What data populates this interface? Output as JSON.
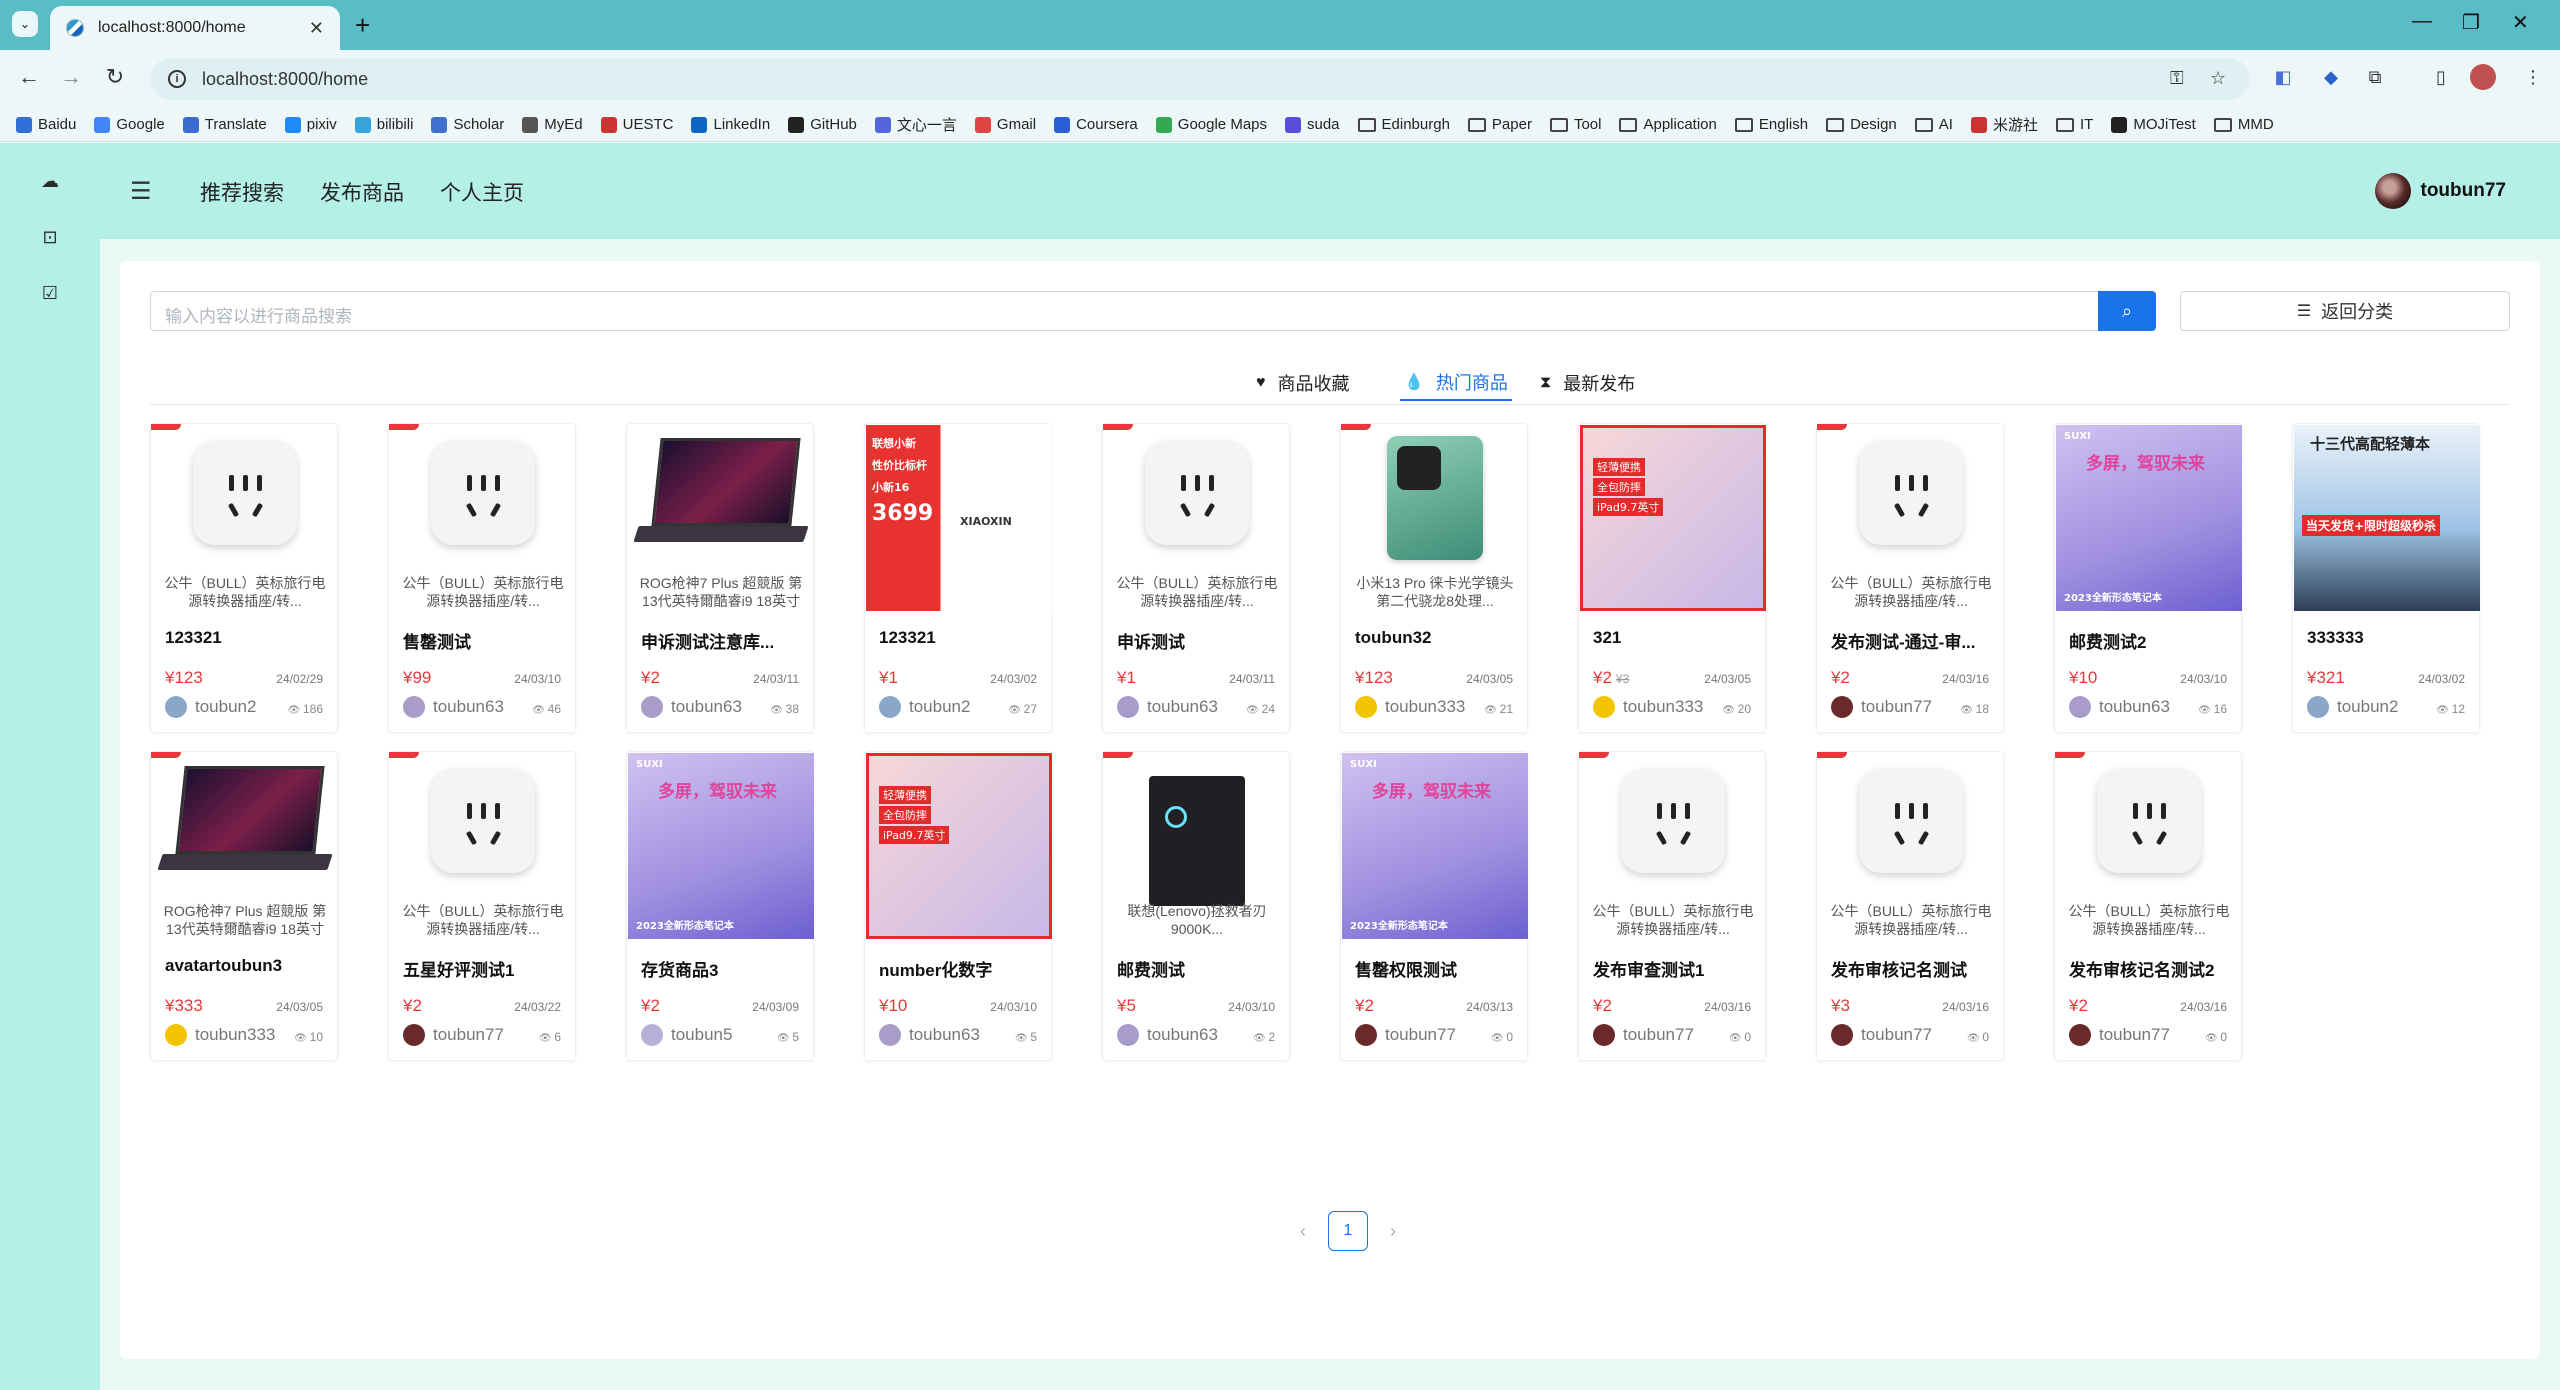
{
  "browser": {
    "tab_title": "localhost:8000/home",
    "url": "localhost:8000/home",
    "bookmarks": [
      "Baidu",
      "Google",
      "Translate",
      "pixiv",
      "bilibili",
      "Scholar",
      "MyEd",
      "UESTC",
      "LinkedIn",
      "GitHub",
      "文心一言",
      "Gmail",
      "Coursera",
      "Google Maps",
      "suda",
      "Edinburgh",
      "Paper",
      "Tool",
      "Application",
      "English",
      "Design",
      "AI",
      "米游社",
      "IT",
      "MOJiTest",
      "MMD"
    ],
    "folder_bookmarks": [
      "Edinburgh",
      "Paper",
      "Tool",
      "Application",
      "English",
      "Design",
      "AI",
      "IT",
      "MMD"
    ]
  },
  "nav": {
    "links": [
      "推荐搜索",
      "发布商品",
      "个人主页"
    ],
    "username": "toubun77"
  },
  "search": {
    "placeholder": "输入内容以进行商品搜索",
    "back_label": "返回分类"
  },
  "tabs": [
    {
      "label": "商品收藏",
      "icon": "heart-icon",
      "active": false
    },
    {
      "label": "热门商品",
      "icon": "flame-icon",
      "active": true
    },
    {
      "label": "最新发布",
      "icon": "hourglass-icon",
      "active": false
    }
  ],
  "products": [
    {
      "thumb": "plug",
      "desc": "公牛（BULL）英标旅行电源转换器插座/转...",
      "title": "123321",
      "price": "¥123",
      "old_price": "",
      "date": "24/02/29",
      "seller": "toubun2",
      "views": "186",
      "avatar": "#8aa6c8",
      "ribbon": true
    },
    {
      "thumb": "plug",
      "desc": "公牛（BULL）英标旅行电源转换器插座/转...",
      "title": "售罄测试",
      "price": "¥99",
      "old_price": "",
      "date": "24/03/10",
      "seller": "toubun63",
      "views": "46",
      "avatar": "#a89cc8",
      "ribbon": true
    },
    {
      "thumb": "laptop",
      "desc": "ROG枪神7 Plus 超競版 第13代英特爾酷睿i9 18英寸",
      "title": "申诉测试注意库...",
      "price": "¥2",
      "old_price": "",
      "date": "24/03/11",
      "seller": "toubun63",
      "views": "38",
      "avatar": "#a89cc8",
      "ribbon": false
    },
    {
      "thumb": "poster-red",
      "desc": "",
      "title": "123321",
      "price": "¥1",
      "old_price": "",
      "date": "24/03/02",
      "seller": "toubun2",
      "views": "27",
      "avatar": "#8aa6c8",
      "ribbon": false
    },
    {
      "thumb": "plug",
      "desc": "公牛（BULL）英标旅行电源转换器插座/转...",
      "title": "申诉测试",
      "price": "¥1",
      "old_price": "",
      "date": "24/03/11",
      "seller": "toubun63",
      "views": "24",
      "avatar": "#a89cc8",
      "ribbon": true
    },
    {
      "thumb": "phone",
      "desc": "小米13 Pro 徕卡光学镜头 第二代骁龙8处理...",
      "title": "toubun32",
      "price": "¥123",
      "old_price": "",
      "date": "24/03/05",
      "seller": "toubun333",
      "views": "21",
      "avatar": "#f5c400",
      "ribbon": true
    },
    {
      "thumb": "poster-tablet",
      "desc": "",
      "title": "321",
      "price": "¥2",
      "old_price": "¥3",
      "date": "24/03/05",
      "seller": "toubun333",
      "views": "20",
      "avatar": "#f5c400",
      "ribbon": false
    },
    {
      "thumb": "plug",
      "desc": "公牛（BULL）英标旅行电源转换器插座/转...",
      "title": "发布测试-通过-审...",
      "price": "¥2",
      "old_price": "",
      "date": "24/03/16",
      "seller": "toubun77",
      "views": "18",
      "avatar": "#6b2a2a",
      "ribbon": true
    },
    {
      "thumb": "poster-purple",
      "desc": "",
      "title": "邮费测试2",
      "price": "¥10",
      "old_price": "",
      "date": "24/03/10",
      "seller": "toubun63",
      "views": "16",
      "avatar": "#a89cc8",
      "ribbon": false
    },
    {
      "thumb": "poster-blue",
      "desc": "",
      "title": "333333",
      "price": "¥321",
      "old_price": "",
      "date": "24/03/02",
      "seller": "toubun2",
      "views": "12",
      "avatar": "#8aa6c8",
      "ribbon": false
    },
    {
      "thumb": "laptop",
      "desc": "ROG枪神7 Plus 超競版 第13代英特爾酷睿i9 18英寸",
      "title": "avatartoubun3",
      "price": "¥333",
      "old_price": "",
      "date": "24/03/05",
      "seller": "toubun333",
      "views": "10",
      "avatar": "#f5c400",
      "ribbon": true
    },
    {
      "thumb": "plug",
      "desc": "公牛（BULL）英标旅行电源转换器插座/转...",
      "title": "五星好评测试1",
      "price": "¥2",
      "old_price": "",
      "date": "24/03/22",
      "seller": "toubun77",
      "views": "6",
      "avatar": "#6b2a2a",
      "ribbon": true
    },
    {
      "thumb": "poster-purple",
      "desc": "",
      "title": "存货商品3",
      "price": "¥2",
      "old_price": "",
      "date": "24/03/09",
      "seller": "toubun5",
      "views": "5",
      "avatar": "#b8b0d8",
      "ribbon": false
    },
    {
      "thumb": "poster-tablet",
      "desc": "",
      "title": "number化数字",
      "price": "¥10",
      "old_price": "",
      "date": "24/03/10",
      "seller": "toubun63",
      "views": "5",
      "avatar": "#a89cc8",
      "ribbon": false
    },
    {
      "thumb": "tower",
      "desc": "联想(Lenovo)拯救者刃9000K...",
      "title": "邮费测试",
      "price": "¥5",
      "old_price": "",
      "date": "24/03/10",
      "seller": "toubun63",
      "views": "2",
      "avatar": "#a89cc8",
      "ribbon": true
    },
    {
      "thumb": "poster-purple",
      "desc": "",
      "title": "售罄权限测试",
      "price": "¥2",
      "old_price": "",
      "date": "24/03/13",
      "seller": "toubun77",
      "views": "0",
      "avatar": "#6b2a2a",
      "ribbon": false
    },
    {
      "thumb": "plug",
      "desc": "公牛（BULL）英标旅行电源转换器插座/转...",
      "title": "发布审查测试1",
      "price": "¥2",
      "old_price": "",
      "date": "24/03/16",
      "seller": "toubun77",
      "views": "0",
      "avatar": "#6b2a2a",
      "ribbon": true
    },
    {
      "thumb": "plug",
      "desc": "公牛（BULL）英标旅行电源转换器插座/转...",
      "title": "发布审核记名测试",
      "price": "¥3",
      "old_price": "",
      "date": "24/03/16",
      "seller": "toubun77",
      "views": "0",
      "avatar": "#6b2a2a",
      "ribbon": true
    },
    {
      "thumb": "plug",
      "desc": "公牛（BULL）英标旅行电源转换器插座/转...",
      "title": "发布审核记名测试2",
      "price": "¥2",
      "old_price": "",
      "date": "24/03/16",
      "seller": "toubun77",
      "views": "0",
      "avatar": "#6b2a2a",
      "ribbon": true
    }
  ],
  "poster_text": {
    "red": [
      "联想小新",
      "性价比标杆",
      "小新16",
      "3699",
      "XIAOXIN"
    ],
    "tablet": [
      "轻薄便携",
      "全包防摔",
      "iPad9.7英寸"
    ],
    "purple": [
      "SUXI",
      "多屏，驾驭未来",
      "2023全新形态笔记本"
    ],
    "blue": [
      "十三代高配轻薄本",
      "当天发货+限时超级秒杀"
    ]
  },
  "pagination": {
    "current": "1"
  },
  "colors": {
    "accent": "#1a73e8",
    "price": "#e4393c",
    "header_bg": "#b4efe8",
    "tab_bar": "#59bcc6"
  }
}
